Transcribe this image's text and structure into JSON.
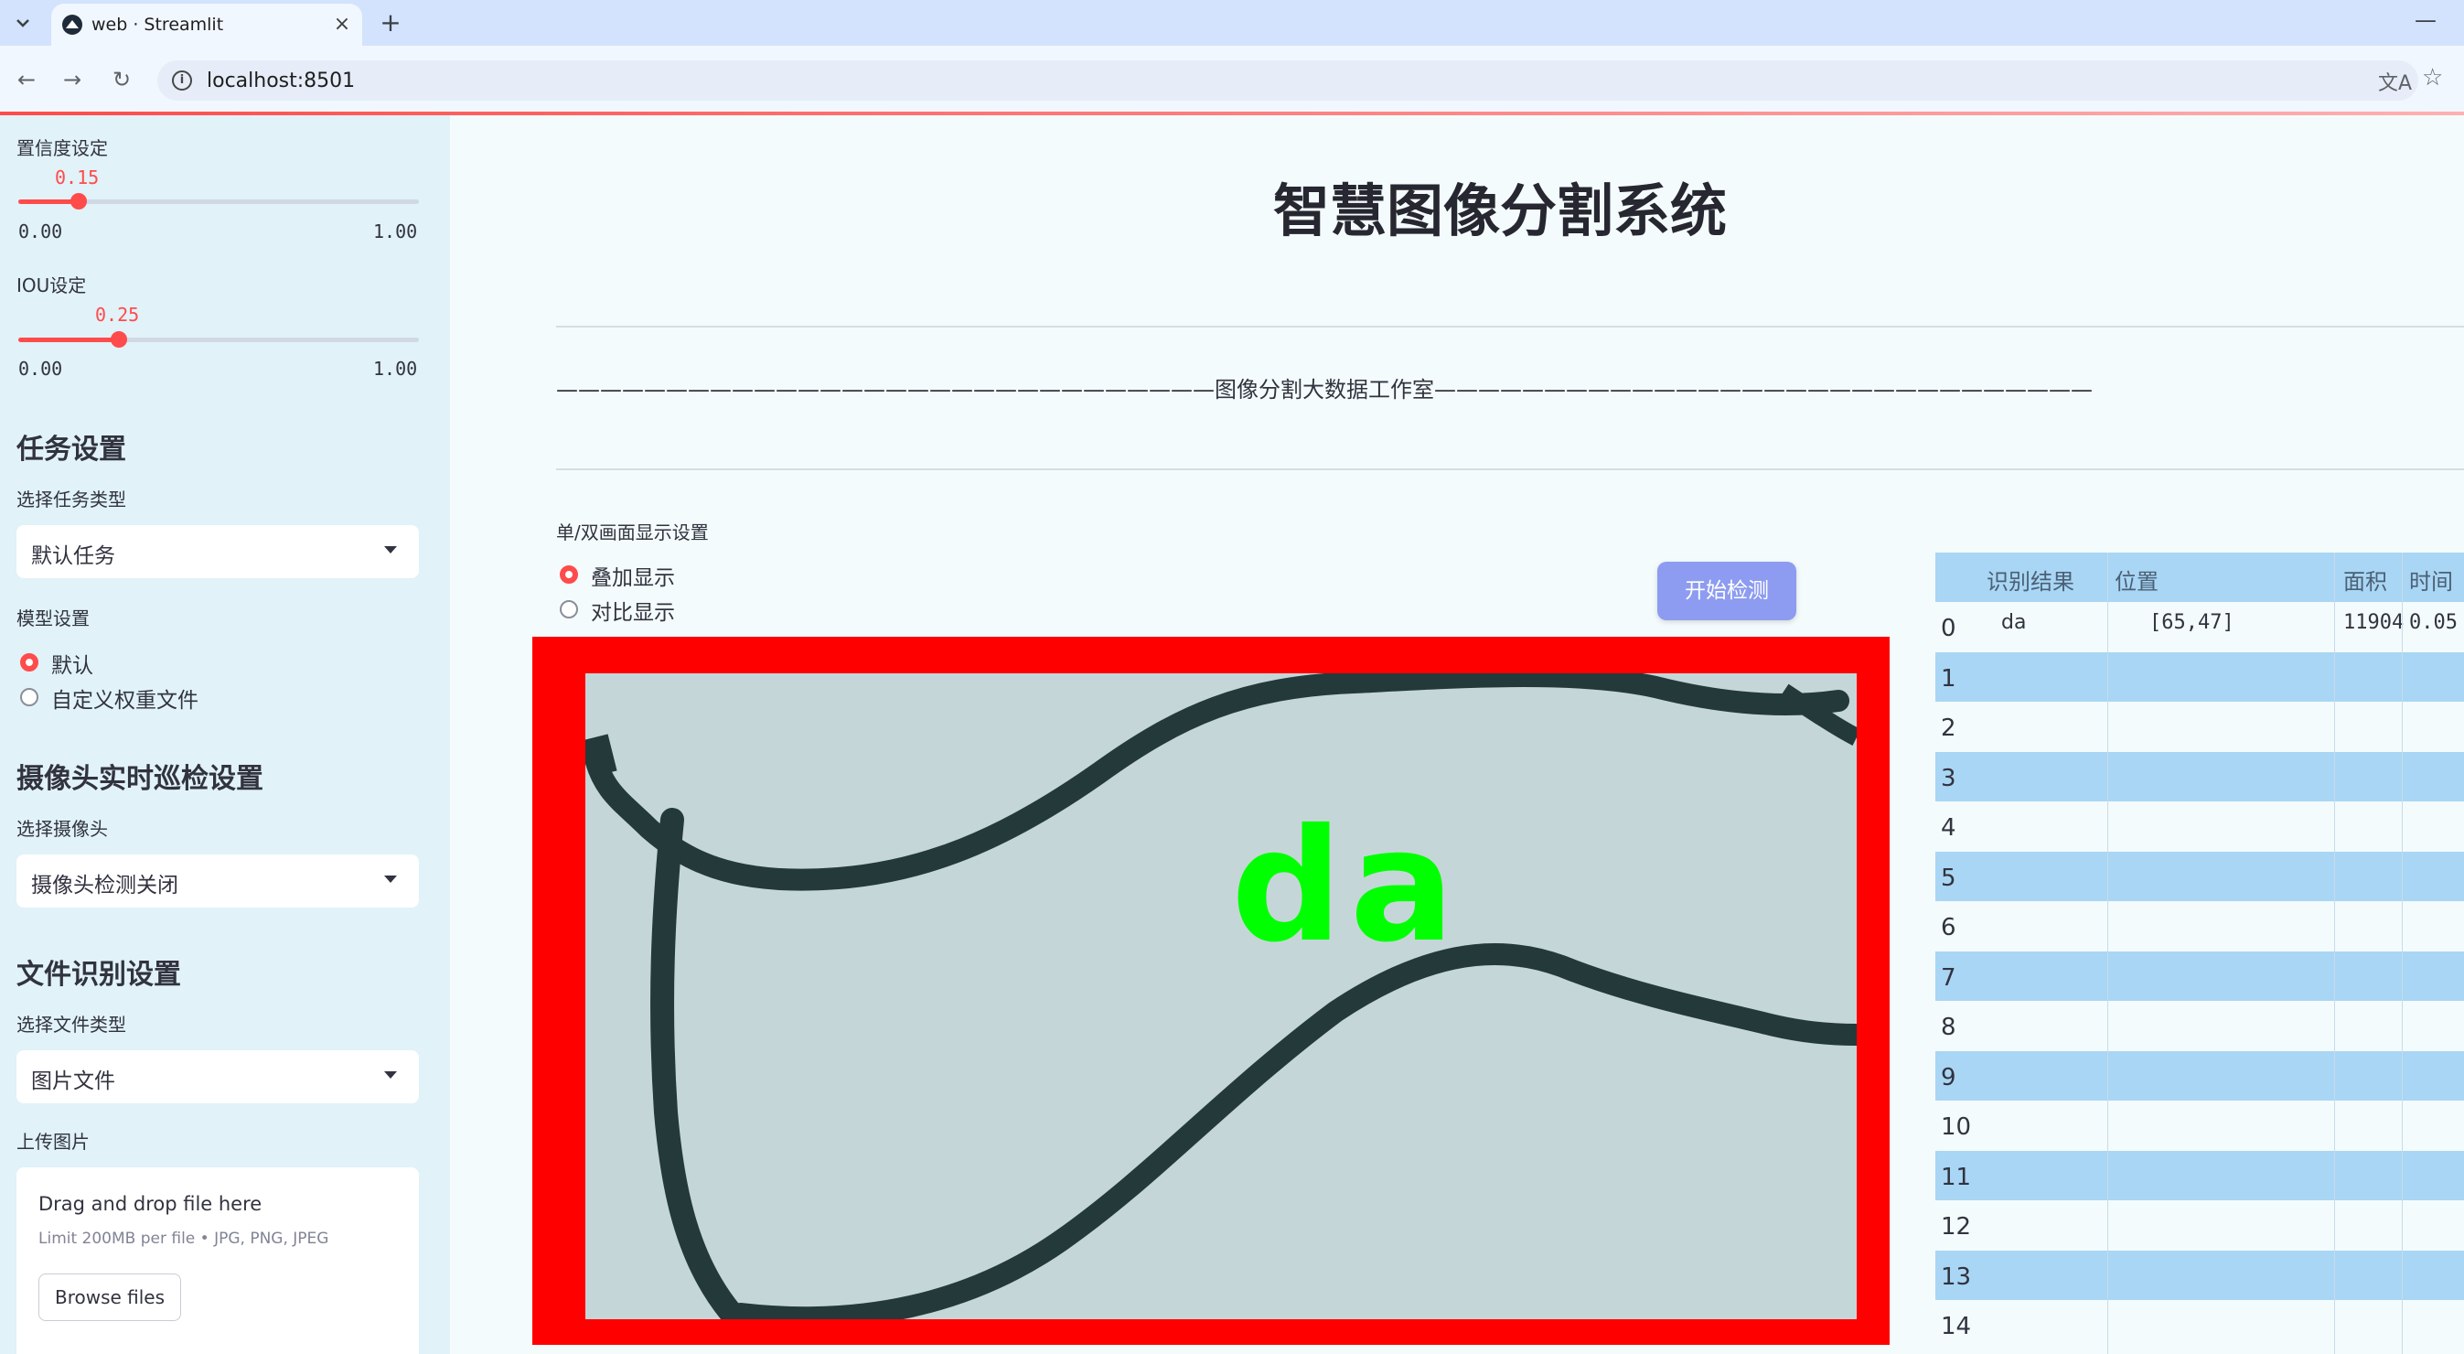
{
  "browser": {
    "tab_title": "web · Streamlit",
    "url": "localhost:8501"
  },
  "sidebar": {
    "confidence": {
      "label": "置信度设定",
      "value": "0.15",
      "value_fraction": 0.15,
      "min": "0.00",
      "max": "1.00"
    },
    "iou": {
      "label": "IOU设定",
      "value": "0.25",
      "value_fraction": 0.25,
      "min": "0.00",
      "max": "1.00"
    },
    "task_heading": "任务设置",
    "task_type_label": "选择任务类型",
    "task_type_value": "默认任务",
    "model_label": "模型设置",
    "model_options": [
      "默认",
      "自定义权重文件"
    ],
    "model_selected": "默认",
    "camera_heading": "摄像头实时巡检设置",
    "camera_label": "选择摄像头",
    "camera_value": "摄像头检测关闭",
    "file_heading": "文件识别设置",
    "file_type_label": "选择文件类型",
    "file_type_value": "图片文件",
    "upload_label": "上传图片",
    "upload_title": "Drag and drop file here",
    "upload_limit": "Limit 200MB per file • JPG, PNG, JPEG",
    "browse_label": "Browse files"
  },
  "main": {
    "title": "智慧图像分割系统",
    "divider_text": "——————————————————————————————图像分割大数据工作室——————————————————————————————",
    "display_label": "单/双画面显示设置",
    "display_options": [
      "叠加显示",
      "对比显示"
    ],
    "display_selected": "叠加显示",
    "start_button": "开始检测",
    "detection_label": "da"
  },
  "table": {
    "columns": [
      "识别结果",
      "位置",
      "面积",
      "时间"
    ],
    "rows": [
      {
        "idx": "0",
        "result": "da",
        "position": "[65,47]",
        "area": "11904",
        "time": "0.05"
      },
      {
        "idx": "1"
      },
      {
        "idx": "2"
      },
      {
        "idx": "3"
      },
      {
        "idx": "4"
      },
      {
        "idx": "5"
      },
      {
        "idx": "6"
      },
      {
        "idx": "7"
      },
      {
        "idx": "8"
      },
      {
        "idx": "9"
      },
      {
        "idx": "10"
      },
      {
        "idx": "11"
      },
      {
        "idx": "12"
      },
      {
        "idx": "13"
      },
      {
        "idx": "14"
      }
    ]
  },
  "colors": {
    "accent": "#ff4b4b",
    "button": "#8d9cf0",
    "frame": "#ff0000",
    "mask_text": "#00ff00",
    "stroke": "#24393a"
  }
}
